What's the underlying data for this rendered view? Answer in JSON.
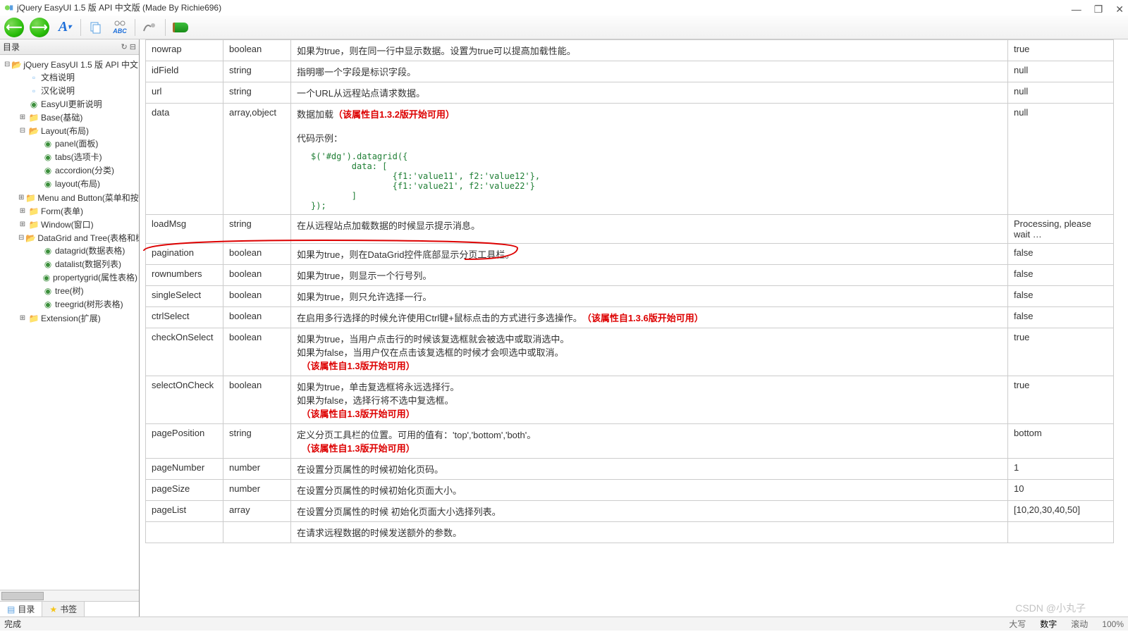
{
  "window": {
    "title": "jQuery EasyUI 1.5 版 API 中文版 (Made By Richie696)"
  },
  "win_controls": {
    "min": "—",
    "max": "❐",
    "close": "✕"
  },
  "sidebar": {
    "title": "目录",
    "root": "jQuery EasyUI 1.5 版 API 中文",
    "docs": [
      {
        "icon": "page",
        "label": "文档说明"
      },
      {
        "icon": "page",
        "label": "汉化说明"
      },
      {
        "icon": "globe",
        "label": "EasyUI更新说明"
      }
    ],
    "groups": [
      {
        "label": "Base(基础)",
        "open": false
      },
      {
        "label": "Layout(布局)",
        "open": true,
        "children": [
          {
            "icon": "globe",
            "label": "panel(面板)"
          },
          {
            "icon": "globe",
            "label": "tabs(选项卡)"
          },
          {
            "icon": "globe",
            "label": "accordion(分类)"
          },
          {
            "icon": "globe",
            "label": "layout(布局)"
          }
        ]
      },
      {
        "label": "Menu and Button(菜单和按",
        "open": false
      },
      {
        "label": "Form(表单)",
        "open": false
      },
      {
        "label": "Window(窗口)",
        "open": false
      },
      {
        "label": "DataGrid and Tree(表格和树",
        "open": true,
        "children": [
          {
            "icon": "globe",
            "label": "datagrid(数据表格)"
          },
          {
            "icon": "globe",
            "label": "datalist(数据列表)"
          },
          {
            "icon": "globe",
            "label": "propertygrid(属性表格)"
          },
          {
            "icon": "globe",
            "label": "tree(树)"
          },
          {
            "icon": "globe",
            "label": "treegrid(树形表格)"
          }
        ]
      },
      {
        "label": "Extension(扩展)",
        "open": false
      }
    ],
    "tabs": {
      "toc": "目录",
      "bookmark": "书签"
    }
  },
  "rows": [
    {
      "name": "nowrap",
      "type": "boolean",
      "desc": "如果为true，则在同一行中显示数据。设置为true可以提高加载性能。",
      "def": "true"
    },
    {
      "name": "idField",
      "type": "string",
      "desc": "指明哪一个字段是标识字段。",
      "def": "null"
    },
    {
      "name": "url",
      "type": "string",
      "desc": "一个URL从远程站点请求数据。",
      "def": "null"
    },
    {
      "name": "data",
      "type": "array,object",
      "desc": "数据加载",
      "red": "（该属性自1.3.2版开始可用）",
      "extra": "代码示例：",
      "code": "$('#dg').datagrid({\n        data: [\n                {f1:'value11', f2:'value12'},\n                {f1:'value21', f2:'value22'}\n        ]\n});",
      "def": "null"
    },
    {
      "name": "loadMsg",
      "type": "string",
      "desc": "在从远程站点加载数据的时候显示提示消息。",
      "def": "Processing, please wait …"
    },
    {
      "name": "pagination",
      "type": "boolean",
      "desc": "如果为true，则在DataGrid控件底部显示分页工具栏。",
      "def": "false",
      "highlight": true
    },
    {
      "name": "rownumbers",
      "type": "boolean",
      "desc": "如果为true，则显示一个行号列。",
      "def": "false"
    },
    {
      "name": "singleSelect",
      "type": "boolean",
      "desc": "如果为true，则只允许选择一行。",
      "def": "false"
    },
    {
      "name": "ctrlSelect",
      "type": "boolean",
      "desc": "在启用多行选择的时候允许使用Ctrl键+鼠标点击的方式进行多选操作。　",
      "red": "（该属性自1.3.6版开始可用）",
      "def": "false"
    },
    {
      "name": "checkOnSelect",
      "type": "boolean",
      "desc": "如果为true，当用户点击行的时候该复选框就会被选中或取消选中。\n如果为false，当用户仅在点击该复选框的时候才会呗选中或取消。",
      "red2": "（该属性自1.3版开始可用）",
      "def": "true"
    },
    {
      "name": "selectOnCheck",
      "type": "boolean",
      "desc": "如果为true，单击复选框将永远选择行。\n如果为false，选择行将不选中复选框。",
      "red2": "（该属性自1.3版开始可用）",
      "def": "true"
    },
    {
      "name": "pagePosition",
      "type": "string",
      "desc": "定义分页工具栏的位置。可用的值有：'top','bottom','both'。",
      "red2": "（该属性自1.3版开始可用）",
      "def": "bottom"
    },
    {
      "name": "pageNumber",
      "type": "number",
      "desc": "在设置分页属性的时候初始化页码。",
      "def": "1"
    },
    {
      "name": "pageSize",
      "type": "number",
      "desc": "在设置分页属性的时候初始化页面大小。",
      "def": "10"
    },
    {
      "name": "pageList",
      "type": "array",
      "desc": "在设置分页属性的时候 初始化页面大小选择列表。",
      "def": "[10,20,30,40,50]"
    },
    {
      "name": "",
      "type": "",
      "desc": "在请求远程数据的时候发送额外的参数。",
      "def": ""
    }
  ],
  "status": {
    "left": "完成",
    "right1": "大写",
    "right2": "数字",
    "right3": "滚动",
    "zoom": "100%"
  },
  "watermark": "CSDN @小丸子"
}
